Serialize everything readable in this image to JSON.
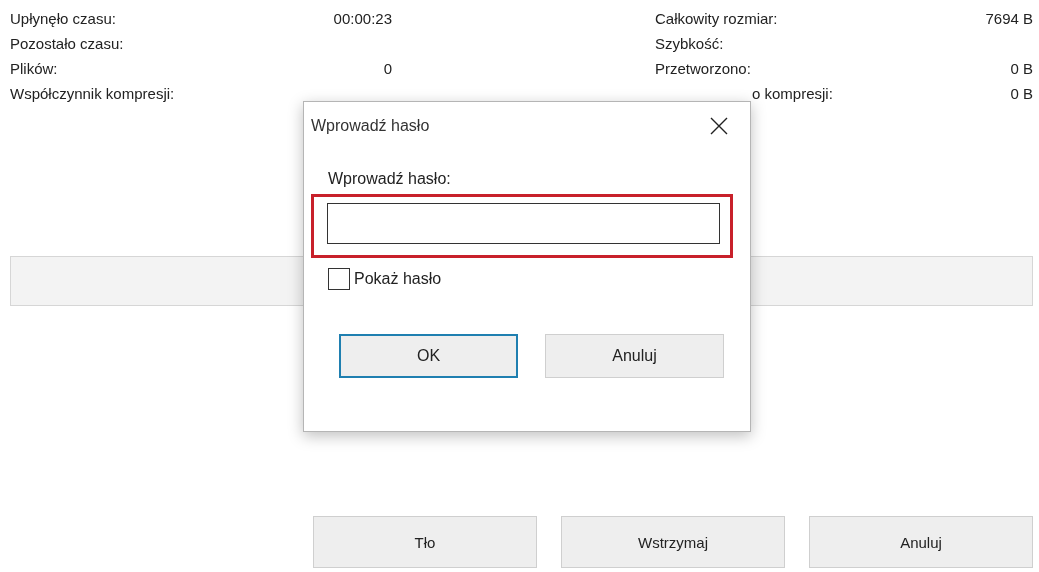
{
  "stats": [
    {
      "label": "Upłynęło czasu:",
      "value": "00:00:23"
    },
    {
      "label": "Pozostało czasu:"
    },
    {
      "label": "Plików:",
      "value": "0"
    },
    {
      "label": "Współczynnik kompresji:"
    }
  ],
  "stats_right": [
    {
      "label": "Całkowity rozmiar:",
      "value": "7694 B",
      "cut_left": false
    },
    {
      "label": "Szybkość:",
      "cut_left": false
    },
    {
      "label": "Przetworzono:",
      "value": "0 B",
      "cut_left": false
    },
    {
      "label": "o kompresji:",
      "value": "0 B",
      "cut_left": true
    }
  ],
  "progress": {
    "level": 0
  },
  "buttons": [
    "Tło",
    "Wstrzymaj",
    "Anuluj"
  ],
  "dialog": {
    "title": "Wprowadź hasło",
    "field_label": "Wprowadź hasło:",
    "password": {
      "focused": true
    },
    "show_password": {
      "label": "Pokaż hasło",
      "checked": false
    },
    "buttons": [
      {
        "label": "OK",
        "default": true
      },
      {
        "label": "Anuluj",
        "default": false
      }
    ]
  }
}
